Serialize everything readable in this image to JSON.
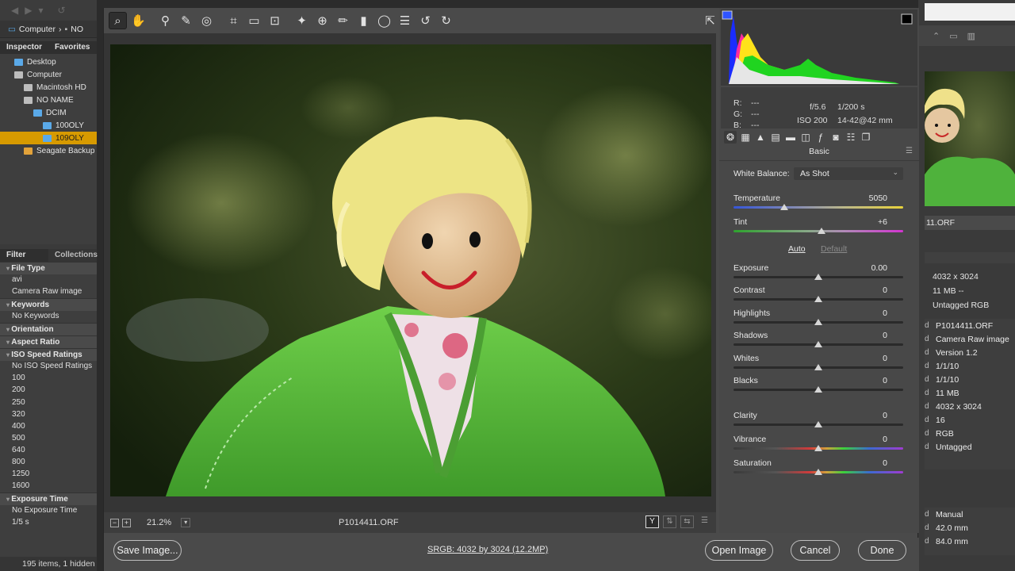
{
  "bridge_left": {
    "breadcrumb": {
      "computer": "Computer",
      "next": "NO"
    },
    "tabs": {
      "inspector": "Inspector",
      "favorites": "Favorites"
    },
    "folders": [
      {
        "label": "Desktop",
        "indent": 1,
        "icon": "blue",
        "selected": false
      },
      {
        "label": "Computer",
        "indent": 1,
        "icon": "grey",
        "selected": false
      },
      {
        "label": "Macintosh HD",
        "indent": 2,
        "icon": "grey",
        "selected": false
      },
      {
        "label": "NO NAME",
        "indent": 2,
        "icon": "grey",
        "selected": false
      },
      {
        "label": "DCIM",
        "indent": 3,
        "icon": "blue",
        "selected": false
      },
      {
        "label": "100OLY",
        "indent": 4,
        "icon": "blue",
        "selected": false
      },
      {
        "label": "109OLY",
        "indent": 4,
        "icon": "blue",
        "selected": true
      },
      {
        "label": "Seagate Backup",
        "indent": 2,
        "icon": "orange",
        "selected": false
      }
    ],
    "filter_tabs": {
      "filter": "Filter",
      "collections": "Collections"
    },
    "filter_rows": [
      {
        "type": "head",
        "text": "File Type"
      },
      {
        "type": "item",
        "text": "avi"
      },
      {
        "type": "item",
        "text": "Camera Raw image"
      },
      {
        "type": "head",
        "text": "Keywords"
      },
      {
        "type": "item",
        "text": "No Keywords"
      },
      {
        "type": "head",
        "text": "Orientation"
      },
      {
        "type": "head",
        "text": "Aspect Ratio"
      },
      {
        "type": "head",
        "text": "ISO Speed Ratings"
      },
      {
        "type": "item",
        "text": "No ISO Speed Ratings"
      },
      {
        "type": "item",
        "text": "100"
      },
      {
        "type": "item",
        "text": "200"
      },
      {
        "type": "item",
        "text": "250"
      },
      {
        "type": "item",
        "text": "320"
      },
      {
        "type": "item",
        "text": "400"
      },
      {
        "type": "item",
        "text": "500"
      },
      {
        "type": "item",
        "text": "640"
      },
      {
        "type": "item",
        "text": "800"
      },
      {
        "type": "item",
        "text": "1250"
      },
      {
        "type": "item",
        "text": "1600"
      },
      {
        "type": "head",
        "text": "Exposure Time"
      },
      {
        "type": "item",
        "text": "No Exposure Time"
      },
      {
        "type": "item",
        "text": "1/5 s"
      }
    ],
    "status": "195 items, 1 hidden"
  },
  "bridge_right": {
    "thumb_label": "11.ORF",
    "quick_meta": [
      "4032 x 3024",
      "11 MB    --",
      "Untagged RGB"
    ],
    "metadata_values": [
      "P1014411.ORF",
      "Camera Raw image",
      "Version 1.2",
      "1/1/10",
      "1/1/10",
      "11 MB",
      "4032 x 3024",
      "16",
      "RGB",
      "Untagged"
    ],
    "metadata_values2": [
      "Manual",
      "42.0 mm",
      "84.0 mm"
    ]
  },
  "acr": {
    "zoom_level": "21.2%",
    "file_name": "P1014411.ORF",
    "workflow_link": "SRGB: 4032 by 3024 (12.2MP)",
    "buttons": {
      "save_image": "Save Image...",
      "open_image": "Open Image",
      "cancel": "Cancel",
      "done": "Done"
    },
    "readout": {
      "r_label": "R:",
      "g_label": "G:",
      "b_label": "B:",
      "r": "---",
      "g": "---",
      "b": "---",
      "aperture": "f/5.6",
      "shutter": "1/200 s",
      "iso": "ISO 200",
      "lens": "14-42@42 mm"
    },
    "panel_title": "Basic",
    "white_balance": {
      "label": "White Balance:",
      "value": "As Shot"
    },
    "auto_label": "Auto",
    "default_label": "Default",
    "sliders": [
      {
        "id": "temperature",
        "label": "Temperature",
        "value": "5050",
        "position": 0.3,
        "track": "temp"
      },
      {
        "id": "tint",
        "label": "Tint",
        "value": "+6",
        "position": 0.52,
        "track": "tint"
      },
      {
        "id": "exposure",
        "label": "Exposure",
        "value": "0.00",
        "position": 0.5,
        "track": "plain"
      },
      {
        "id": "contrast",
        "label": "Contrast",
        "value": "0",
        "position": 0.5,
        "track": "plain"
      },
      {
        "id": "highlights",
        "label": "Highlights",
        "value": "0",
        "position": 0.5,
        "track": "plain"
      },
      {
        "id": "shadows",
        "label": "Shadows",
        "value": "0",
        "position": 0.5,
        "track": "plain"
      },
      {
        "id": "whites",
        "label": "Whites",
        "value": "0",
        "position": 0.5,
        "track": "plain"
      },
      {
        "id": "blacks",
        "label": "Blacks",
        "value": "0",
        "position": 0.5,
        "track": "plain"
      },
      {
        "id": "clarity",
        "label": "Clarity",
        "value": "0",
        "position": 0.5,
        "track": "plain"
      },
      {
        "id": "vibrance",
        "label": "Vibrance",
        "value": "0",
        "position": 0.5,
        "track": "vib"
      },
      {
        "id": "saturation",
        "label": "Saturation",
        "value": "0",
        "position": 0.5,
        "track": "vib"
      }
    ]
  }
}
